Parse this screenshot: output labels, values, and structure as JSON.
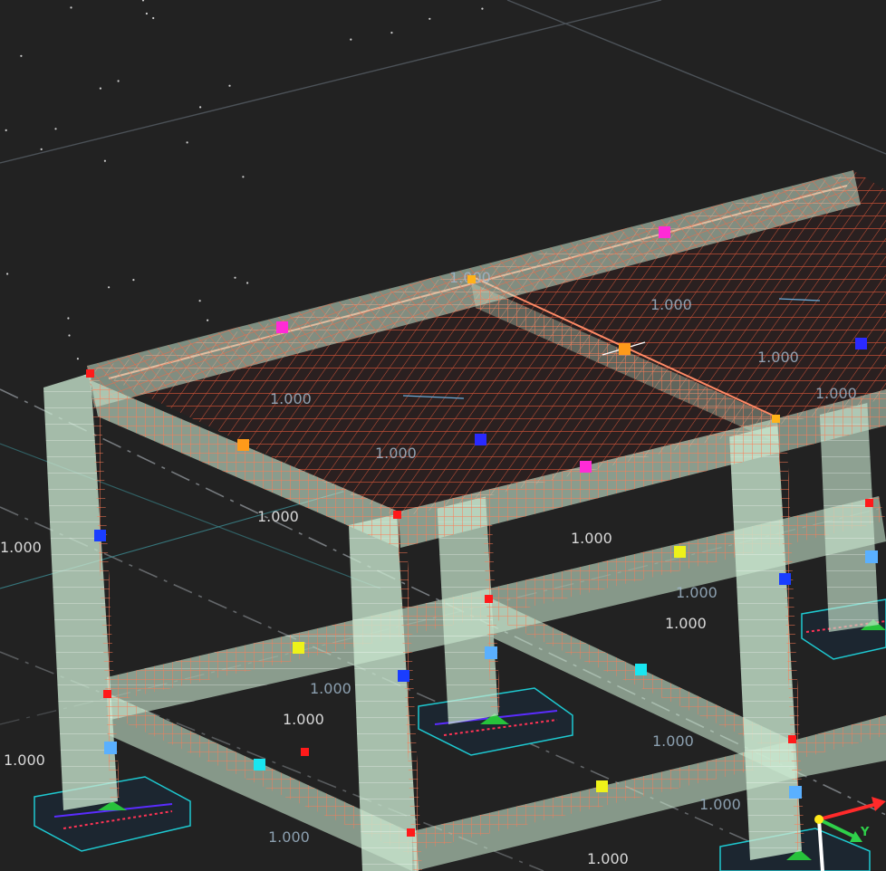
{
  "viewport": {
    "background": "#222222",
    "grid_color": "#4a4f55",
    "column_color": "#c9e7cf",
    "rebar_color": "#f06a4a",
    "slab_mesh_color": "#e85a3c",
    "dim_color": "#6aa9d6"
  },
  "dimension_labels": {
    "slab_left": "1.000",
    "slab_center": "1.000",
    "slab_right_top": "1.000",
    "slab_right_mid": "1.000",
    "top_beam_front": "1.000",
    "top_beam_right": "1.000",
    "left_column": "1.000",
    "left_footing": "1.000",
    "mid_beam_a": "1.000",
    "mid_beam_b": "1.000",
    "mid_beam_c": "1.000",
    "mid_beam_d": "1.000",
    "front_beam_a": "1.000",
    "front_beam_b": "1.000",
    "front_beam_c": "1.000",
    "front_beam_d": "1.000",
    "top_ghost_a": "1.000",
    "top_ghost_b": "1.000"
  },
  "axis_triad": {
    "x_color": "#ff2a2a",
    "y_label": "Y",
    "y_color": "#2fd04a",
    "z_color": "#ffffff"
  },
  "node_markers": [
    {
      "kind": "magenta",
      "color": "#ff2bd6"
    },
    {
      "kind": "orange",
      "color": "#ff9a1a"
    },
    {
      "kind": "blue",
      "color": "#1a3dff"
    },
    {
      "kind": "yellow",
      "color": "#eef21a"
    },
    {
      "kind": "cyan",
      "color": "#19e6f0"
    },
    {
      "kind": "light-blue",
      "color": "#5ab0ff"
    },
    {
      "kind": "red",
      "color": "#ff1a1a"
    }
  ]
}
